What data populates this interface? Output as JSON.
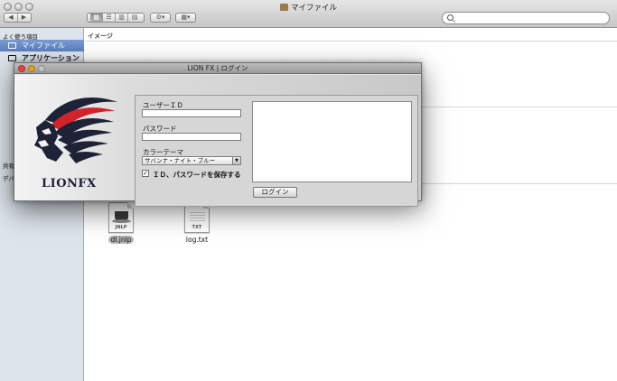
{
  "finder": {
    "title": "マイファイル",
    "sidebar": {
      "favorites_header": "よく使う項目",
      "items": [
        {
          "label": "マイファイル",
          "selected": true
        },
        {
          "label": "アプリケーション",
          "selected": false
        }
      ],
      "shared_header": "共有",
      "devices_header": "デバ"
    },
    "content": {
      "section_header": "イメージ",
      "files": [
        {
          "name": "dl.jnlp",
          "ext": "JNLP",
          "selected": true,
          "icon": "java-cup-icon"
        },
        {
          "name": "log.txt",
          "ext": "TXT",
          "selected": false,
          "icon": "text-document-icon"
        }
      ]
    }
  },
  "dialog": {
    "title": "LION FX | ログイン",
    "brand": "LIONFX",
    "user_id_label": "ユーザーＩＤ",
    "user_id_value": "",
    "password_label": "パスワード",
    "password_value": "",
    "color_theme_label": "カラーテーマ",
    "color_theme_value": "サバンナ・ナイト・ブルー",
    "save_checkbox_label": "ＩＤ、パスワードを保存する",
    "save_checked": true,
    "login_button": "ログイン"
  },
  "colors": {
    "sidebar_selected": "#6a8cc8",
    "close_red": "#e0443e",
    "minimize_yellow": "#dea123",
    "zoom_green": "#6cbf43",
    "lion_navy": "#1d2237",
    "lion_red": "#d2232a"
  }
}
